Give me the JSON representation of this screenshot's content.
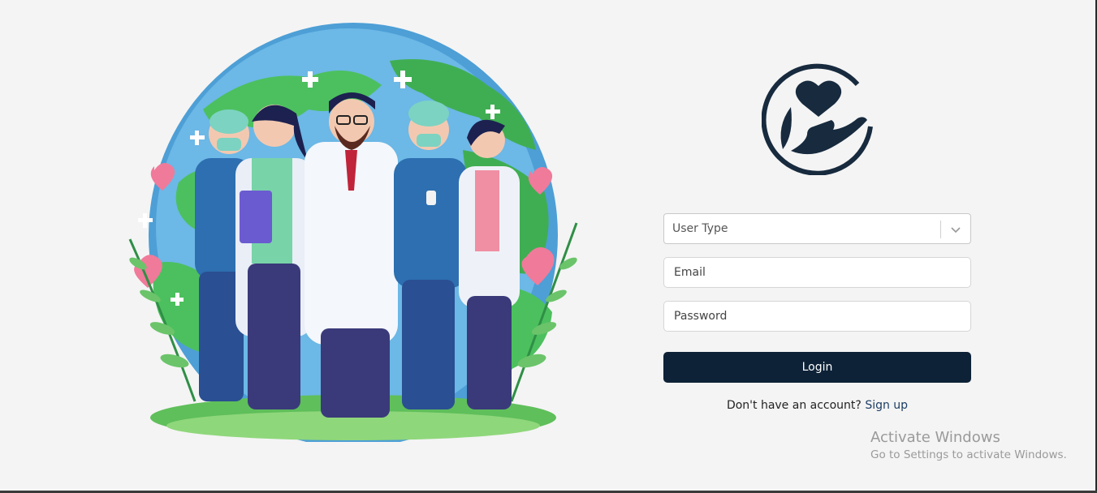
{
  "form": {
    "user_type_placeholder": "User Type",
    "email_placeholder": "Email",
    "password_placeholder": "Password",
    "login_label": "Login",
    "signup_prompt": "Don't have an account?",
    "signup_link": "Sign up"
  },
  "watermark": {
    "title": "Activate Windows",
    "subtitle": "Go to Settings to activate Windows."
  },
  "illustration": {
    "description_icon": "healthcare-team-globe-illustration"
  },
  "logo": {
    "icon": "heart-hand-icon"
  },
  "colors": {
    "primary": "#0d2237",
    "background": "#f4f4f4",
    "link": "#1c3d63"
  }
}
